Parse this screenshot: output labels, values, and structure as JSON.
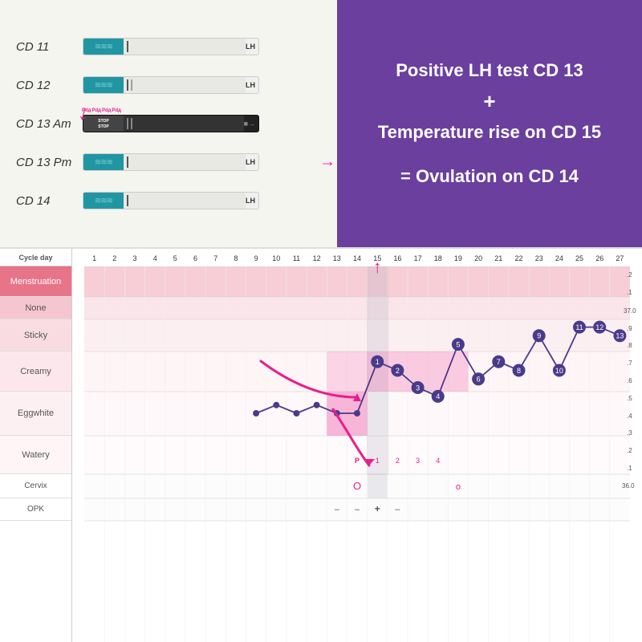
{
  "top": {
    "photo_bg": "#f5f5f0",
    "strips": [
      {
        "label": "CD 11",
        "type": "normal",
        "lines": 1
      },
      {
        "label": "CD 12",
        "type": "normal",
        "lines": 2
      },
      {
        "label": "CD 13 Am",
        "type": "dark",
        "lines": 3
      },
      {
        "label": "CD 13 Pm",
        "type": "normal",
        "lines": 1
      },
      {
        "label": "CD 14",
        "type": "normal",
        "lines": 1
      }
    ],
    "info": {
      "line1": "Positive LH test CD 13",
      "line2": "+",
      "line3": "Temperature rise on CD 15",
      "line4": "",
      "line5": "= Ovulation on CD 14"
    }
  },
  "chart": {
    "cycle_days": [
      1,
      2,
      3,
      4,
      5,
      6,
      7,
      8,
      9,
      10,
      11,
      12,
      13,
      14,
      15,
      16,
      17,
      18,
      19,
      20,
      21,
      22,
      23,
      24,
      25,
      26,
      27
    ],
    "y_labels": [
      "Menstruation",
      "None",
      "Sticky",
      "Creamy",
      "Eggwhite",
      "Watery",
      "Cervix",
      "OPK"
    ],
    "temp_scale": [
      "37.0",
      "36.9",
      "36.8",
      "36.7",
      "36.6",
      "36.5",
      "36.4",
      "36.3",
      "36.2",
      "36.1",
      "36.0"
    ],
    "temp_labels_right": [
      ".2",
      ".1",
      "37.0",
      ".9",
      ".8",
      ".7",
      ".6",
      ".5",
      ".4",
      ".3",
      ".2",
      ".1",
      "36.0"
    ],
    "data_points": [
      {
        "cd": 9,
        "temp": 36.35,
        "label": null
      },
      {
        "cd": 10,
        "temp": 36.4,
        "label": null
      },
      {
        "cd": 11,
        "temp": 36.35,
        "label": null
      },
      {
        "cd": 12,
        "temp": 36.4,
        "label": null
      },
      {
        "cd": 13,
        "temp": 36.35,
        "label": null
      },
      {
        "cd": 14,
        "temp": 36.35,
        "label": null
      },
      {
        "cd": 15,
        "temp": 36.65,
        "label": "1"
      },
      {
        "cd": 16,
        "temp": 36.6,
        "label": "2"
      },
      {
        "cd": 17,
        "temp": 36.5,
        "label": "3"
      },
      {
        "cd": 18,
        "temp": 36.45,
        "label": "4"
      },
      {
        "cd": 19,
        "temp": 36.75,
        "label": "5"
      },
      {
        "cd": 20,
        "temp": 36.55,
        "label": "6"
      },
      {
        "cd": 21,
        "temp": 36.65,
        "label": "7"
      },
      {
        "cd": 22,
        "temp": 36.6,
        "label": "8"
      },
      {
        "cd": 23,
        "temp": 36.8,
        "label": "9"
      },
      {
        "cd": 24,
        "temp": 36.6,
        "label": "10"
      },
      {
        "cd": 25,
        "temp": 36.85,
        "label": "11"
      },
      {
        "cd": 26,
        "temp": 36.85,
        "label": "12"
      },
      {
        "cd": 27,
        "temp": 36.8,
        "label": "13"
      }
    ],
    "pink_bars": [
      {
        "cd_start": 13,
        "cd_end": 14,
        "row": "eggwhite"
      },
      {
        "cd_start": 15,
        "cd_end": 19,
        "row": "creamy"
      }
    ],
    "cervix_markers": [
      {
        "cd": 14,
        "symbol": "O"
      },
      {
        "cd": 19,
        "symbol": "o"
      }
    ],
    "opk_markers": [
      {
        "cd": 13,
        "symbol": "–"
      },
      {
        "cd": 14,
        "symbol": "–"
      },
      {
        "cd": 15,
        "symbol": "+"
      },
      {
        "cd": 16,
        "symbol": "–"
      }
    ],
    "post_labels": [
      "P",
      "1",
      "2",
      "3",
      "4"
    ],
    "highlight_cd": 15
  }
}
